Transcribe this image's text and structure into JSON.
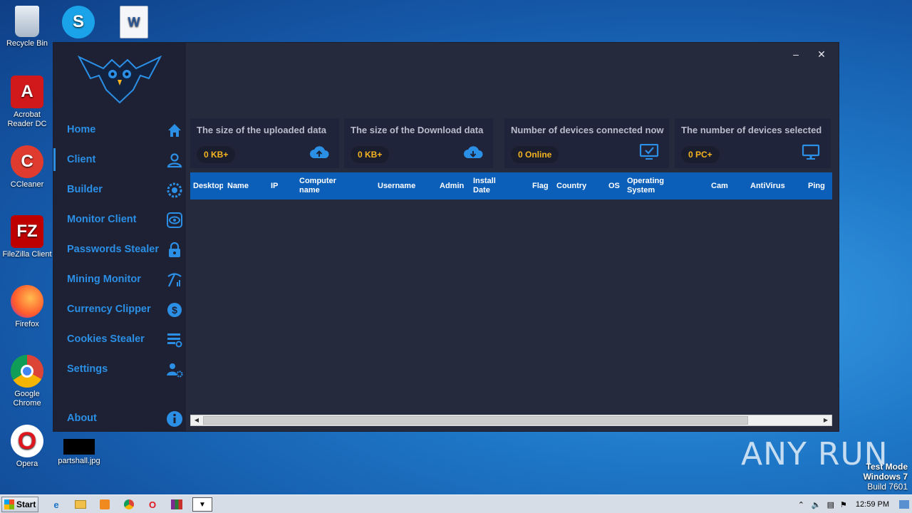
{
  "desktop": {
    "icons": [
      {
        "label": "Recycle Bin"
      },
      {
        "label": ""
      },
      {
        "label": ""
      },
      {
        "label": "Acrobat Reader DC"
      },
      {
        "label": "CCleaner"
      },
      {
        "label": "FileZilla Client"
      },
      {
        "label": "Firefox"
      },
      {
        "label": "Google Chrome"
      },
      {
        "label": "Opera"
      },
      {
        "label": "partshall.jpg"
      }
    ],
    "watermark": "ANY RUN",
    "test_mode": [
      "Test Mode",
      "Windows 7",
      "Build 7601"
    ]
  },
  "app": {
    "sidebar": {
      "items": [
        {
          "label": "Home",
          "icon": "home-icon"
        },
        {
          "label": "Client",
          "icon": "user-icon"
        },
        {
          "label": "Builder",
          "icon": "gear-icon"
        },
        {
          "label": "Monitor Client",
          "icon": "eye-icon"
        },
        {
          "label": "Passwords Stealer",
          "icon": "lock-icon"
        },
        {
          "label": "Mining Monitor",
          "icon": "pickaxe-icon"
        },
        {
          "label": "Currency Clipper",
          "icon": "dollar-icon"
        },
        {
          "label": "Cookies Stealer",
          "icon": "list-icon"
        },
        {
          "label": "Settings",
          "icon": "user-settings-icon"
        },
        {
          "label": "About",
          "icon": "info-icon"
        }
      ],
      "active_index": 1
    },
    "window": {
      "minimize": "–",
      "close": "✕"
    },
    "cards": [
      {
        "title": "The size of the uploaded data",
        "value": "0 KB+",
        "icon": "cloud-upload-icon"
      },
      {
        "title": "The size of the Download data",
        "value": "0 KB+",
        "icon": "cloud-download-icon"
      },
      {
        "title": "Number of devices connected now",
        "value": "0 Online",
        "icon": "monitor-check-icon"
      },
      {
        "title": "The number of devices selected",
        "value": "0 PC+",
        "icon": "monitor-icon"
      }
    ],
    "grid": {
      "columns": [
        "Desktop",
        "Name",
        "IP",
        "Computer name",
        "Username",
        "Admin",
        "Install Date",
        "Flag",
        "Country",
        "OS",
        "Operating System",
        "Cam",
        "AntiVirus",
        "Ping"
      ],
      "rows": []
    },
    "colors": {
      "accent": "#2b8fe6",
      "value": "#f5b520",
      "header": "#0b5fb8"
    }
  },
  "taskbar": {
    "start_label": "Start",
    "clock": "12:59 PM"
  }
}
